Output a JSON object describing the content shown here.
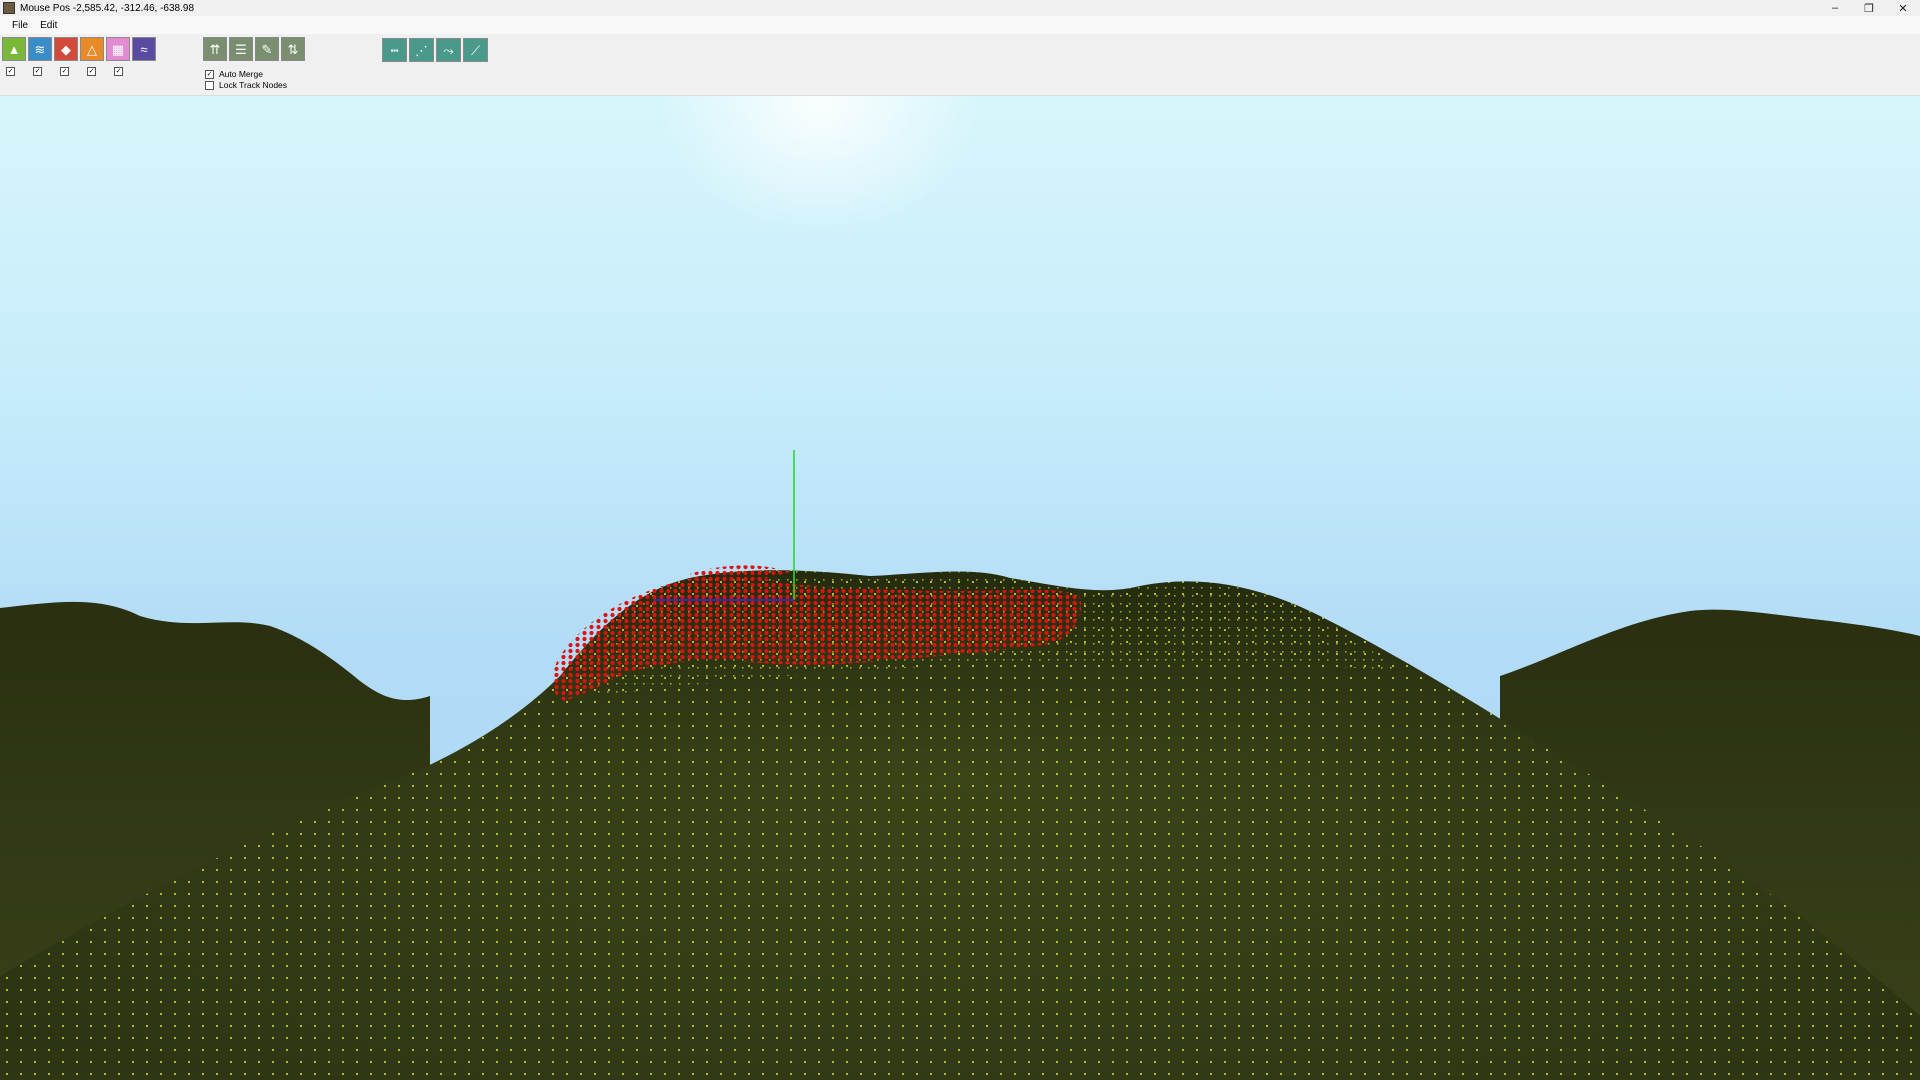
{
  "window": {
    "title": "Mouse Pos -2,585.42, -312.46, -638.98",
    "controls": {
      "minimize": "–",
      "restore": "❐",
      "close": "✕"
    }
  },
  "menu": {
    "items": [
      {
        "label": "File"
      },
      {
        "label": "Edit"
      }
    ]
  },
  "toolbar": {
    "group1": [
      {
        "icon": "terrain-mountain-icon",
        "glyph": "▲",
        "color": "#7ab83a"
      },
      {
        "icon": "river-water-icon",
        "glyph": "≋",
        "color": "#3a8dc9"
      },
      {
        "icon": "shapes-objects-icon",
        "glyph": "◆",
        "color": "#d24a3a"
      },
      {
        "icon": "node-graph-icon",
        "glyph": "△",
        "color": "#e8892a"
      },
      {
        "icon": "texture-layers-icon",
        "glyph": "▦",
        "color": "#e48ad2"
      },
      {
        "icon": "wave-noise-icon",
        "glyph": "≈",
        "color": "#5a4aa0"
      }
    ],
    "group1_checks": [
      true,
      true,
      true,
      true,
      true
    ],
    "group2": [
      {
        "icon": "raise-terrain-icon",
        "glyph": "⇈"
      },
      {
        "icon": "flatten-terrain-icon",
        "glyph": "☰"
      },
      {
        "icon": "paint-brush-icon",
        "glyph": "✎"
      },
      {
        "icon": "smooth-terrain-icon",
        "glyph": "⇅"
      }
    ],
    "options": [
      {
        "label": "Auto Merge",
        "checked": true
      },
      {
        "label": "Lock Track Nodes",
        "checked": false
      }
    ],
    "group3": [
      {
        "icon": "track-flat-icon",
        "glyph": "┅"
      },
      {
        "icon": "track-slope-icon",
        "glyph": "⋰"
      },
      {
        "icon": "track-curve-icon",
        "glyph": "⤳"
      },
      {
        "icon": "track-ramp-icon",
        "glyph": "⟋"
      }
    ]
  },
  "viewport": {
    "colors": {
      "terrain": "#3a4418",
      "terrain_dark": "#262d10",
      "grid_points": "#c8d62a",
      "selection_points": "#e01010",
      "axis_y": "#2ad82a",
      "axis_x": "#3030d8"
    }
  }
}
